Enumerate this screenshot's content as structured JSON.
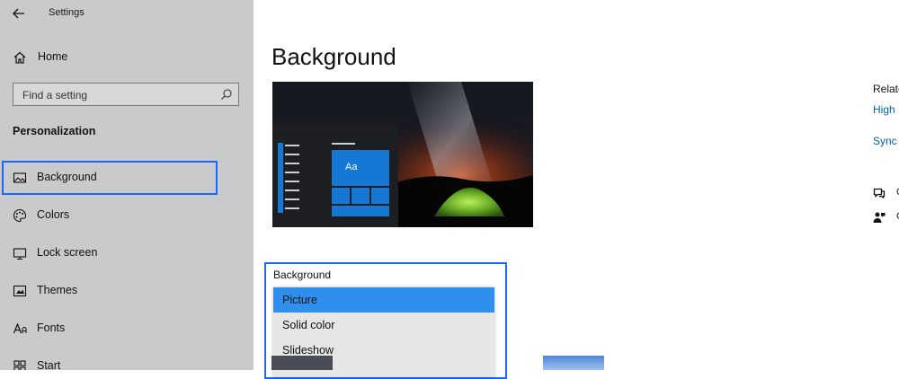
{
  "window": {
    "title": "Settings"
  },
  "sidebar": {
    "home_label": "Home",
    "search_placeholder": "Find a setting",
    "section_title": "Personalization",
    "items": [
      {
        "label": "Background",
        "icon": "image-icon",
        "selected": true
      },
      {
        "label": "Colors",
        "icon": "palette-icon"
      },
      {
        "label": "Lock screen",
        "icon": "lock-screen-icon"
      },
      {
        "label": "Themes",
        "icon": "themes-icon"
      },
      {
        "label": "Fonts",
        "icon": "fonts-icon"
      },
      {
        "label": "Start",
        "icon": "start-icon"
      }
    ]
  },
  "main": {
    "title": "Background",
    "preview": {
      "tile_label": "Aa"
    },
    "background_dropdown": {
      "label": "Background",
      "options": [
        "Picture",
        "Solid color",
        "Slideshow"
      ],
      "selected": "Picture"
    }
  },
  "related": {
    "heading": "Relate",
    "links": [
      "High",
      "Sync y"
    ],
    "icon_rows": [
      {
        "icon": "chat-help-icon",
        "text": "G"
      },
      {
        "icon": "feedback-icon",
        "text": "G"
      }
    ]
  },
  "colors": {
    "accent": "#1a66ff",
    "sidebar_bg": "#c8cacc",
    "link": "#0063b1",
    "selected_option": "#2f8fec",
    "tile_blue": "#1478d4"
  }
}
